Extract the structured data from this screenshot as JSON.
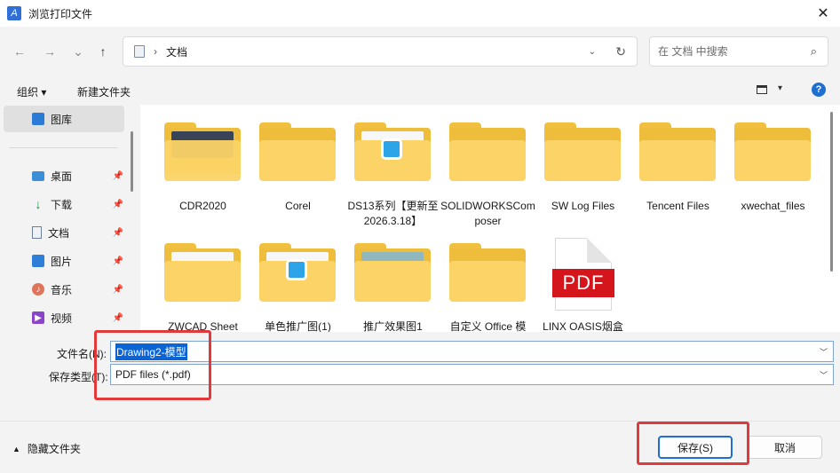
{
  "window": {
    "title": "浏览打印文件",
    "close_glyph": "✕",
    "app_icon_glyph": "A"
  },
  "nav": {
    "back": "←",
    "forward": "→",
    "history": "⌄",
    "up": "↑"
  },
  "address": {
    "separator": "›",
    "crumb": "文档",
    "dropdown": "⌄",
    "refresh": "↻"
  },
  "search": {
    "placeholder": "在 文档 中搜索",
    "icon": "⌕"
  },
  "commands": {
    "organize": "组织 ▾",
    "new_folder": "新建文件夹",
    "view_dropdown": "▾",
    "help": "?"
  },
  "sidebar": {
    "items": [
      {
        "label": "图库",
        "icon": "gallery-icon",
        "pinned": false
      },
      {
        "label": "桌面",
        "icon": "desktop-icon",
        "pinned": true
      },
      {
        "label": "下载",
        "icon": "download-icon",
        "pinned": true
      },
      {
        "label": "文档",
        "icon": "document-icon",
        "pinned": true
      },
      {
        "label": "图片",
        "icon": "pictures-icon",
        "pinned": true
      },
      {
        "label": "音乐",
        "icon": "music-icon",
        "pinned": true
      },
      {
        "label": "视频",
        "icon": "video-icon",
        "pinned": true
      }
    ]
  },
  "files": [
    {
      "name": "CDR2020",
      "type": "folder"
    },
    {
      "name": "Corel",
      "type": "folder"
    },
    {
      "name": "DS13系列【更新至2026.3.18】",
      "type": "folder"
    },
    {
      "name": "SOLIDWORKSComposer",
      "type": "folder"
    },
    {
      "name": "SW Log Files",
      "type": "folder"
    },
    {
      "name": "Tencent Files",
      "type": "folder"
    },
    {
      "name": "xwechat_files",
      "type": "folder"
    },
    {
      "name": "ZWCAD Sheet",
      "type": "folder"
    },
    {
      "name": "单色推广图(1)",
      "type": "folder"
    },
    {
      "name": "推广效果图1",
      "type": "folder"
    },
    {
      "name": "自定义 Office 模",
      "type": "folder"
    },
    {
      "name": "LINX OASIS烟盒",
      "type": "pdf",
      "badge": "PDF"
    }
  ],
  "form": {
    "filename_label": "文件名(N):",
    "filename_value": "Drawing2-模型",
    "filetype_label": "保存类型(T):",
    "filetype_value": "PDF files (*.pdf)"
  },
  "footer": {
    "hide_folders": "隐藏文件夹",
    "save": "保存(S)",
    "cancel": "取消"
  },
  "colors": {
    "accent": "#1f6fd1",
    "highlight": "#e23a3a",
    "folder": "#fbd366",
    "pdf_red": "#d4161c"
  }
}
